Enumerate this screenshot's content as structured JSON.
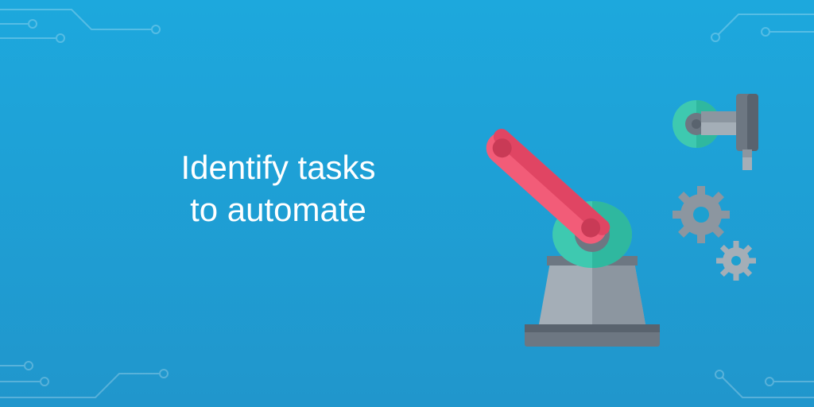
{
  "heading": {
    "line1": "Identify tasks",
    "line2": "to automate"
  }
}
